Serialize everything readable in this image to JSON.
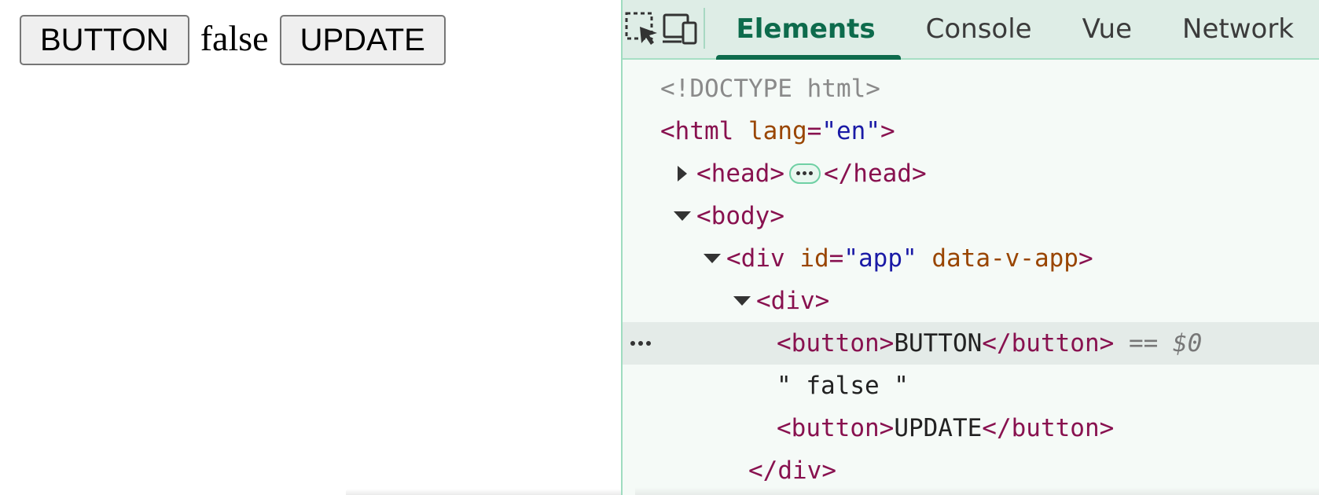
{
  "page": {
    "button_label": "BUTTON",
    "state_text": "false",
    "update_label": "UPDATE"
  },
  "devtools": {
    "icons": [
      "inspect-element-icon",
      "device-emulation-icon"
    ],
    "tabs": [
      {
        "label": "Elements",
        "active": true
      },
      {
        "label": "Console",
        "active": false
      },
      {
        "label": "Vue",
        "active": false
      },
      {
        "label": "Network",
        "active": false
      }
    ],
    "tree": {
      "doctype": "<!DOCTYPE html>",
      "html_open": "<html",
      "html_attr": "lang",
      "html_attr_value": "\"en\"",
      "html_close": ">",
      "head_open": "<head>",
      "head_close": "</head>",
      "body_open": "<body>",
      "div_open": "<div",
      "div_id_attr": "id",
      "div_id_value": "\"app\"",
      "div_v_attr": "data-v-app",
      "div_close_bracket": ">",
      "inner_div_open": "<div>",
      "button_open": "<button>",
      "button_text": "BUTTON",
      "button_close": "</button>",
      "selected_ref": "== $0",
      "text_node": "\" false \"",
      "update_open": "<button>",
      "update_text": "UPDATE",
      "update_close": "</button>",
      "inner_div_close": "</div>"
    }
  },
  "colors": {
    "accent": "#0d6b4c",
    "tag": "#88114f",
    "attr": "#994500",
    "value": "#1a1aa6",
    "toolbar_bg": "#deede6",
    "panel_bg": "#f5faf7"
  }
}
